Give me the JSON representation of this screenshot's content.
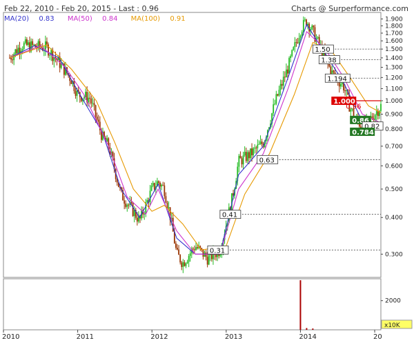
{
  "header": {
    "left": "Feb 22, 2010 - Feb 20, 2015 - Last : 0.96",
    "right": "Charts @ Surperformance.com"
  },
  "legend": [
    {
      "name": "MA(20)",
      "value": "0.83",
      "color": "#3333cc"
    },
    {
      "name": "MA(50)",
      "value": "0.84",
      "color": "#cc33cc"
    },
    {
      "name": "MA(100)",
      "value": "0.91",
      "color": "#e69900"
    }
  ],
  "colors": {
    "up": "#22bb22",
    "down": "#993300",
    "ma20": "#3333cc",
    "ma50": "#cc33cc",
    "ma100": "#e69900",
    "level": "#333333",
    "red_level": "#dd0000",
    "volume": "#aa0000",
    "frame": "#888888"
  },
  "chart_data": {
    "type": "candlestick",
    "y_scale": "log",
    "ylim": [
      0.25,
      2.0
    ],
    "y_ticks": [
      "1.900",
      "1.800",
      "1.700",
      "1.600",
      "1.500",
      "1.400",
      "1.300",
      "1.200",
      "1.100",
      "1.000",
      "0.900",
      "0.800",
      "0.700",
      "0.600",
      "0.500",
      "0.400",
      "0.300"
    ],
    "x_ticks": [
      "2010",
      "2011",
      "2012",
      "2013",
      "2014",
      "20"
    ],
    "xlim": [
      "2010-01",
      "2015-02"
    ],
    "price_path": [
      [
        "2010-02",
        1.4
      ],
      [
        "2010-03",
        1.48
      ],
      [
        "2010-04",
        1.55
      ],
      [
        "2010-06",
        1.53
      ],
      [
        "2010-08",
        1.52
      ],
      [
        "2010-10",
        1.35
      ],
      [
        "2010-12",
        1.18
      ],
      [
        "2011-01",
        1.05
      ],
      [
        "2011-03",
        1.02
      ],
      [
        "2011-05",
        0.75
      ],
      [
        "2011-06",
        0.7
      ],
      [
        "2011-08",
        0.48
      ],
      [
        "2011-10",
        0.42
      ],
      [
        "2011-11",
        0.39
      ],
      [
        "2011-12",
        0.44
      ],
      [
        "2012-01",
        0.5
      ],
      [
        "2012-02",
        0.53
      ],
      [
        "2012-03",
        0.5
      ],
      [
        "2012-04",
        0.4
      ],
      [
        "2012-05",
        0.3
      ],
      [
        "2012-06",
        0.28
      ],
      [
        "2012-08",
        0.32
      ],
      [
        "2012-10",
        0.29
      ],
      [
        "2012-12",
        0.31
      ],
      [
        "2013-01",
        0.38
      ],
      [
        "2013-02",
        0.47
      ],
      [
        "2013-03",
        0.62
      ],
      [
        "2013-05",
        0.66
      ],
      [
        "2013-07",
        0.72
      ],
      [
        "2013-09",
        1.0
      ],
      [
        "2013-11",
        1.3
      ],
      [
        "2014-01",
        1.75
      ],
      [
        "2014-02",
        1.88
      ],
      [
        "2014-03",
        1.72
      ],
      [
        "2014-04",
        1.55
      ],
      [
        "2014-05",
        1.4
      ],
      [
        "2014-06",
        1.25
      ],
      [
        "2014-08",
        1.12
      ],
      [
        "2014-09",
        0.95
      ],
      [
        "2014-10",
        0.86
      ],
      [
        "2014-11",
        0.82
      ],
      [
        "2014-12",
        0.85
      ],
      [
        "2015-02",
        0.96
      ]
    ],
    "moving_averages": [
      {
        "name": "MA(20)",
        "points": [
          [
            "2010-02",
            1.4
          ],
          [
            "2010-06",
            1.54
          ],
          [
            "2010-10",
            1.4
          ],
          [
            "2011-01",
            1.08
          ],
          [
            "2011-05",
            0.78
          ],
          [
            "2011-08",
            0.5
          ],
          [
            "2011-11",
            0.4
          ],
          [
            "2012-02",
            0.52
          ],
          [
            "2012-05",
            0.34
          ],
          [
            "2012-08",
            0.3
          ],
          [
            "2012-12",
            0.3
          ],
          [
            "2013-03",
            0.56
          ],
          [
            "2013-07",
            0.7
          ],
          [
            "2013-11",
            1.2
          ],
          [
            "2014-02",
            1.82
          ],
          [
            "2014-05",
            1.45
          ],
          [
            "2014-08",
            1.15
          ],
          [
            "2014-11",
            0.85
          ],
          [
            "2015-02",
            0.83
          ]
        ]
      },
      {
        "name": "MA(50)",
        "points": [
          [
            "2010-02",
            1.4
          ],
          [
            "2010-07",
            1.54
          ],
          [
            "2010-11",
            1.3
          ],
          [
            "2011-02",
            1.05
          ],
          [
            "2011-06",
            0.7
          ],
          [
            "2011-09",
            0.47
          ],
          [
            "2011-12",
            0.41
          ],
          [
            "2012-02",
            0.5
          ],
          [
            "2012-05",
            0.36
          ],
          [
            "2012-08",
            0.3
          ],
          [
            "2012-12",
            0.3
          ],
          [
            "2013-03",
            0.5
          ],
          [
            "2013-07",
            0.66
          ],
          [
            "2013-11",
            1.1
          ],
          [
            "2014-02",
            1.72
          ],
          [
            "2014-05",
            1.5
          ],
          [
            "2014-08",
            1.2
          ],
          [
            "2014-11",
            0.9
          ],
          [
            "2015-02",
            0.84
          ]
        ]
      },
      {
        "name": "MA(100)",
        "points": [
          [
            "2010-02",
            1.4
          ],
          [
            "2010-08",
            1.55
          ],
          [
            "2010-12",
            1.28
          ],
          [
            "2011-04",
            1.0
          ],
          [
            "2011-07",
            0.72
          ],
          [
            "2011-10",
            0.5
          ],
          [
            "2012-01",
            0.42
          ],
          [
            "2012-03",
            0.44
          ],
          [
            "2012-06",
            0.38
          ],
          [
            "2012-09",
            0.31
          ],
          [
            "2013-01",
            0.32
          ],
          [
            "2013-04",
            0.48
          ],
          [
            "2013-08",
            0.66
          ],
          [
            "2013-12",
            1.05
          ],
          [
            "2014-03",
            1.58
          ],
          [
            "2014-06",
            1.48
          ],
          [
            "2014-09",
            1.2
          ],
          [
            "2014-12",
            0.96
          ],
          [
            "2015-02",
            0.91
          ]
        ]
      }
    ],
    "levels": [
      {
        "label": "1.50",
        "value": 1.5,
        "start": "2014-03",
        "style": "box"
      },
      {
        "label": "1.38",
        "value": 1.38,
        "start": "2014-04",
        "style": "box"
      },
      {
        "label": "1.194",
        "value": 1.194,
        "start": "2014-05",
        "style": "box"
      },
      {
        "label": "0.63",
        "value": 0.63,
        "start": "2013-06",
        "style": "box"
      },
      {
        "label": "0.41",
        "value": 0.41,
        "start": "2012-12",
        "style": "box"
      },
      {
        "label": "0.31",
        "value": 0.31,
        "start": "2012-10",
        "style": "box"
      },
      {
        "label": "1.000",
        "value": 1.0,
        "start": "2014-06",
        "style": "red"
      },
      {
        "label": "0.96",
        "value": 0.96,
        "start": "2014-08",
        "style": "redtext"
      },
      {
        "label": "0.86",
        "value": 0.86,
        "start": "2014-09",
        "style": "green"
      },
      {
        "label": "0.82",
        "value": 0.82,
        "start": "2014-11",
        "style": "box"
      },
      {
        "label": "0.784",
        "value": 0.784,
        "start": "2014-09",
        "style": "green"
      }
    ],
    "volume": {
      "unit_label": "x10K",
      "y_ticks": [
        "2000"
      ],
      "ylim": [
        0,
        3500
      ],
      "bars": [
        [
          "2014-01",
          3400
        ],
        [
          "2014-02",
          120
        ],
        [
          "2014-03",
          90
        ]
      ]
    }
  }
}
